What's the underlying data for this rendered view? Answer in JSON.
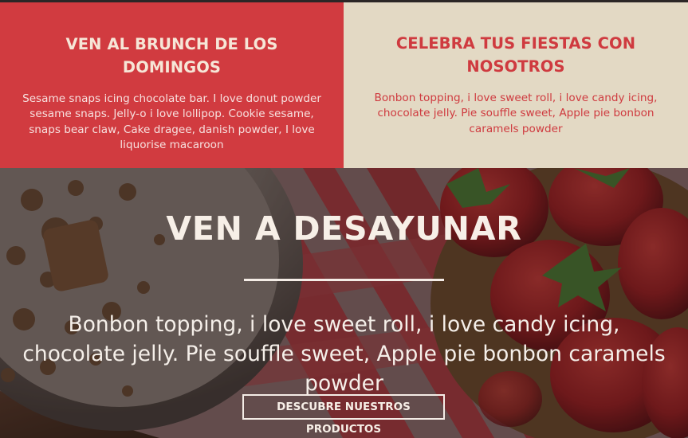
{
  "promos": [
    {
      "title": "VEN AL BRUNCH DE LOS DOMINGOS",
      "text": "Sesame snaps icing chocolate bar. I love donut powder sesame snaps. Jelly-o i love lollipop. Cookie sesame, snaps bear claw, Cake dragee, danish powder, I love liquorise macaroon"
    },
    {
      "title": "CELEBRA TUS FIESTAS CON NOSOTROS",
      "text": "Bonbon topping, i love sweet roll, i love candy icing, chocolate jelly. Pie souffle sweet, Apple pie bonbon caramels powder"
    }
  ],
  "hero": {
    "title": "VEN A DESAYUNAR",
    "text": "Bonbon topping, i love sweet roll, i love candy icing, chocolate jelly. Pie souffle sweet, Apple pie bonbon caramels powder",
    "button_label": "DESCUBRE NUESTROS PRODUCTOS"
  },
  "colors": {
    "brand_red": "#d13b40",
    "cream": "#e3d9c4",
    "hero_text": "#f4ece6"
  }
}
